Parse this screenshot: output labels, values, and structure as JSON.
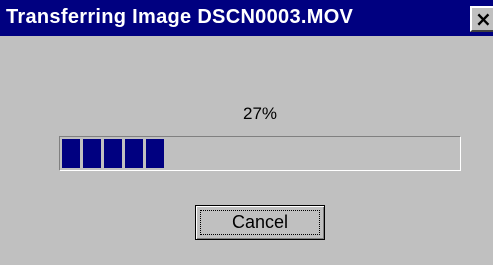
{
  "window": {
    "title": "Transferring Image DSCN0003.MOV",
    "close_glyph": "×",
    "close_icon": "close-icon"
  },
  "progress": {
    "percent_label": "27%",
    "value": 0.27,
    "blocks_filled": 5
  },
  "buttons": {
    "cancel_label": "Cancel"
  },
  "colors": {
    "titlebar": "#000080",
    "face": "#c0c0c0",
    "progress_fill": "#000080"
  }
}
